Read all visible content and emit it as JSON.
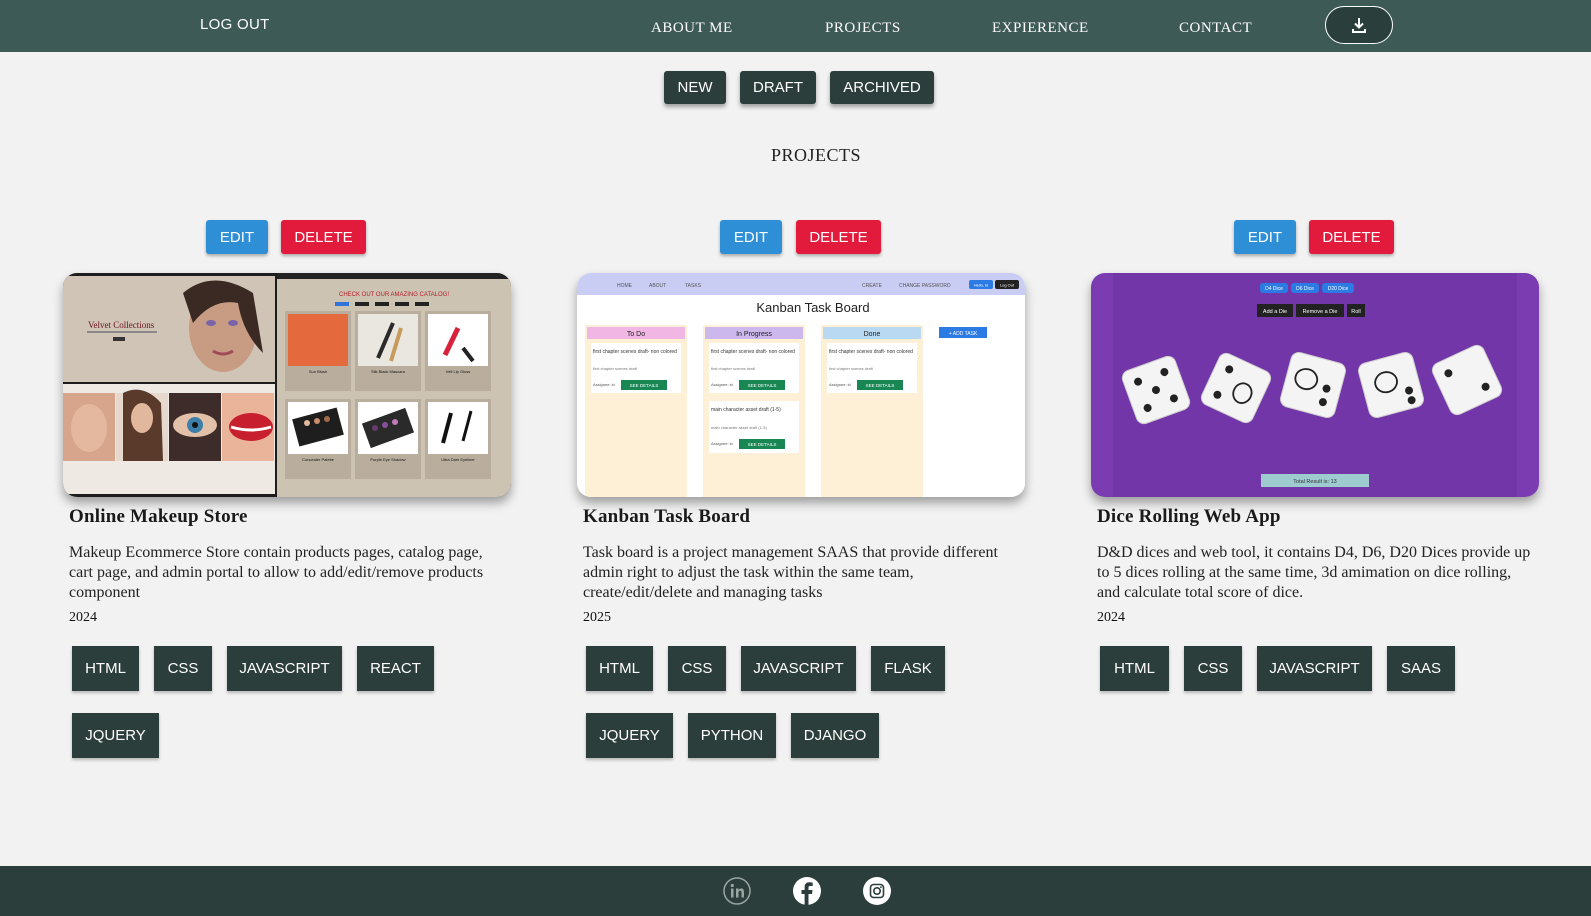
{
  "header": {
    "logout_label": "LOG OUT",
    "nav": [
      "ABOUT ME",
      "PROJECTS",
      "EXPIERENCE",
      "CONTACT"
    ],
    "download_icon": "download-icon"
  },
  "filters": [
    "NEW",
    "DRAFT",
    "ARCHIVED"
  ],
  "section_title": "PROJECTS",
  "actions": {
    "edit_label": "EDIT",
    "delete_label": "DELETE"
  },
  "projects": [
    {
      "title": "Online Makeup Store",
      "description": "Makeup Ecommerce Store contain products pages, catalog page, cart page, and admin portal to allow to add/edit/remove products component",
      "year": "2024",
      "tags": [
        "HTML",
        "CSS",
        "JAVASCRIPT",
        "REACT",
        "JQUERY"
      ],
      "thumb": {
        "brand": "Velvet Collections",
        "catalog_heading": "CHECK OUT OUR AMAZING CATALOG!",
        "products": [
          "Sun Blush",
          "Silk Black Mascara",
          "Velt Lip Gloss",
          "Concealer Palette",
          "Purple Eye Shadow",
          "Ultra Dark Eyeliner"
        ]
      }
    },
    {
      "title": "Kanban Task Board",
      "description": "Task board is a project management SAAS that provide different admin right to adjust the task within the same team, create/edit/delete and managing tasks",
      "year": "2025",
      "tags": [
        "HTML",
        "CSS",
        "JAVASCRIPT",
        "FLASK",
        "JQUERY",
        "PYTHON",
        "DJANGO"
      ],
      "thumb": {
        "nav": [
          "HOME",
          "ABOUT",
          "TASKS"
        ],
        "nav_right": [
          "CREATE",
          "CHANGE PASSWORD"
        ],
        "hello": "Hello, kt",
        "logout": "Log Out",
        "board_title": "Kanban Task Board",
        "columns": [
          "To Do",
          "In Progress",
          "Done"
        ],
        "add_task": "+ ADD TASK",
        "card_title": "first chapter scenes draft- non colored",
        "card_sub": "first chapter scenes draft",
        "card2_title": "main character asset draft (1-5)",
        "card2_sub": "main character asset draft (1-5)",
        "assignee": "Assignee: kt",
        "see_details": "SEE DETAILS"
      }
    },
    {
      "title": "Dice Rolling Web App",
      "description": "D&D dices and web tool, it contains D4, D6, D20 Dices provide up to 5 dices rolling at the same time, 3d amimation on dice rolling, and calculate total score of dice.",
      "year": "2024",
      "tags": [
        "HTML",
        "CSS",
        "JAVASCRIPT",
        "SAAS"
      ],
      "thumb": {
        "dice_buttons": [
          "D4 Dice",
          "D6 Dice",
          "D20 Dice"
        ],
        "controls": [
          "Add a Die",
          "Remove a Die",
          "Roll"
        ],
        "total": "Total Result is: 13"
      }
    }
  ],
  "footer": {
    "icons": [
      "linkedin-icon",
      "facebook-icon",
      "instagram-icon"
    ]
  },
  "colors": {
    "header_bg": "#3e5a56",
    "footer_bg": "#2b3e3b",
    "dark_button": "#2c3e3b",
    "edit": "#2f8fd6",
    "delete": "#e21b3c"
  }
}
